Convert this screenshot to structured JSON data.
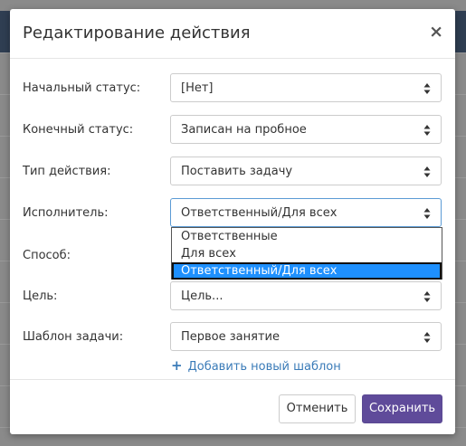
{
  "modal": {
    "title": "Редактирование действия",
    "close_label": "×"
  },
  "fields": {
    "start_status": {
      "label": "Начальный статус:",
      "value": "[Нет]"
    },
    "end_status": {
      "label": "Конечный статус:",
      "value": "Записан на пробное"
    },
    "action_type": {
      "label": "Тип действия:",
      "value": "Поставить задачу"
    },
    "executor": {
      "label": "Исполнитель:",
      "value": "Ответственный/Для всех"
    },
    "method": {
      "label": "Способ:"
    },
    "goal": {
      "label": "Цель:",
      "value": "Цель..."
    },
    "task_template": {
      "label": "Шаблон задачи:",
      "value": "Первое занятие"
    }
  },
  "executor_options": [
    {
      "label": "Ответственные",
      "selected": false
    },
    {
      "label": "Для всех",
      "selected": false
    },
    {
      "label": "Ответственный/Для всех",
      "selected": true
    }
  ],
  "add_template": {
    "icon": "plus-icon",
    "label": "Добавить новый шаблон"
  },
  "footer": {
    "cancel_label": "Отменить",
    "save_label": "Сохранить"
  },
  "colors": {
    "accent": "#5f4b9a",
    "link": "#3a7bb8",
    "selected_option": "#1e90ff",
    "header_backdrop": "#2f3e52"
  }
}
